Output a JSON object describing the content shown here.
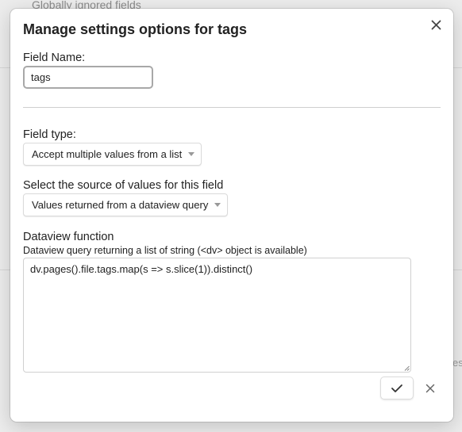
{
  "background": {
    "top_text": "Globally ignored fields",
    "right_text": "es"
  },
  "modal": {
    "title": "Manage settings options for tags",
    "field_name": {
      "label": "Field Name:",
      "value": "tags"
    },
    "field_type": {
      "label": "Field type:",
      "selected": "Accept multiple values from a list"
    },
    "source": {
      "label": "Select the source of values for this field",
      "selected": "Values returned from a dataview query"
    },
    "dataview": {
      "label": "Dataview function",
      "help": "Dataview query returning a list of string (<dv> object is available)",
      "query": "dv.pages().file.tags.map(s => s.slice(1)).distinct()"
    },
    "icons": {
      "close": "close-icon",
      "confirm": "check-icon",
      "cancel": "close-icon"
    }
  }
}
